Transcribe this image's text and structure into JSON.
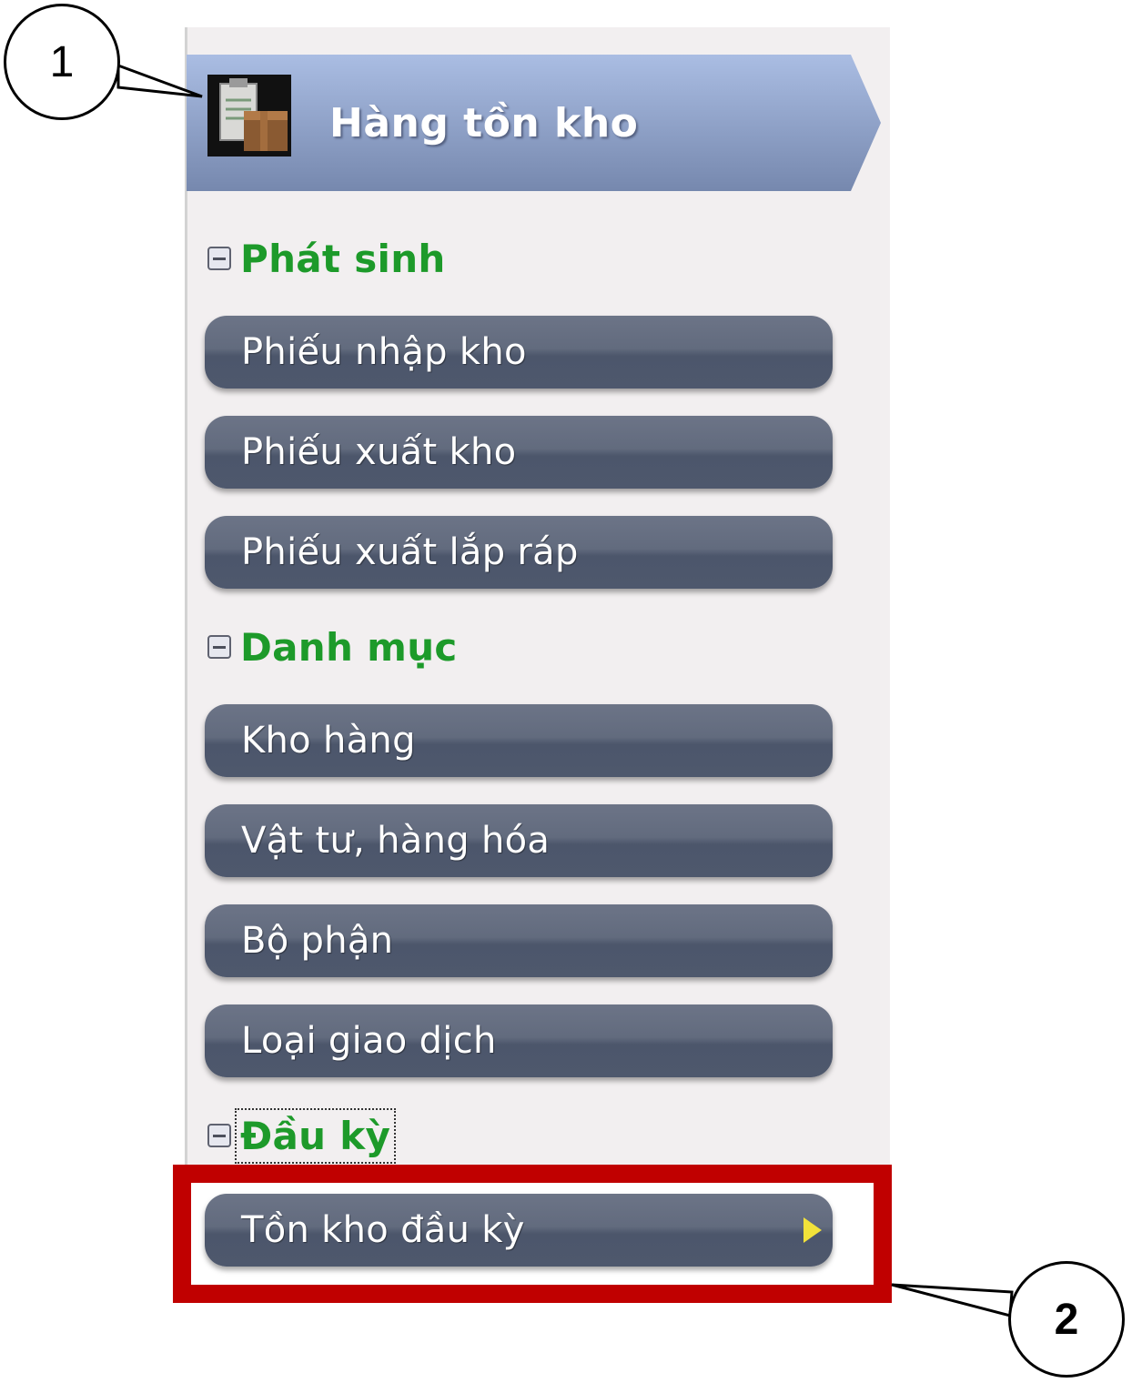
{
  "header": {
    "title": "Hàng tồn kho",
    "icon": "inventory-clipboard-box-icon",
    "gradient_colors": [
      "#a6b9e0",
      "#7e91b8"
    ]
  },
  "groups": [
    {
      "label": "Phát sinh",
      "toggle_icon": "collapse-minus-icon",
      "items": [
        "Phiếu nhập kho",
        "Phiếu xuất kho",
        "Phiếu xuất lắp ráp"
      ]
    },
    {
      "label": "Danh mục",
      "toggle_icon": "collapse-minus-icon",
      "items": [
        "Kho hàng",
        "Vật tư, hàng hóa",
        "Bộ phận",
        "Loại giao dịch"
      ]
    },
    {
      "label": "Đầu kỳ",
      "toggle_icon": "collapse-minus-icon",
      "items": [
        "Tồn kho đầu kỳ"
      ]
    }
  ],
  "callouts": {
    "one": "1",
    "two": "2"
  },
  "colors": {
    "group_label": "#1d9a2a",
    "button": "#555f74",
    "highlight_border": "#c00000",
    "arrow": "#f2e23a"
  }
}
